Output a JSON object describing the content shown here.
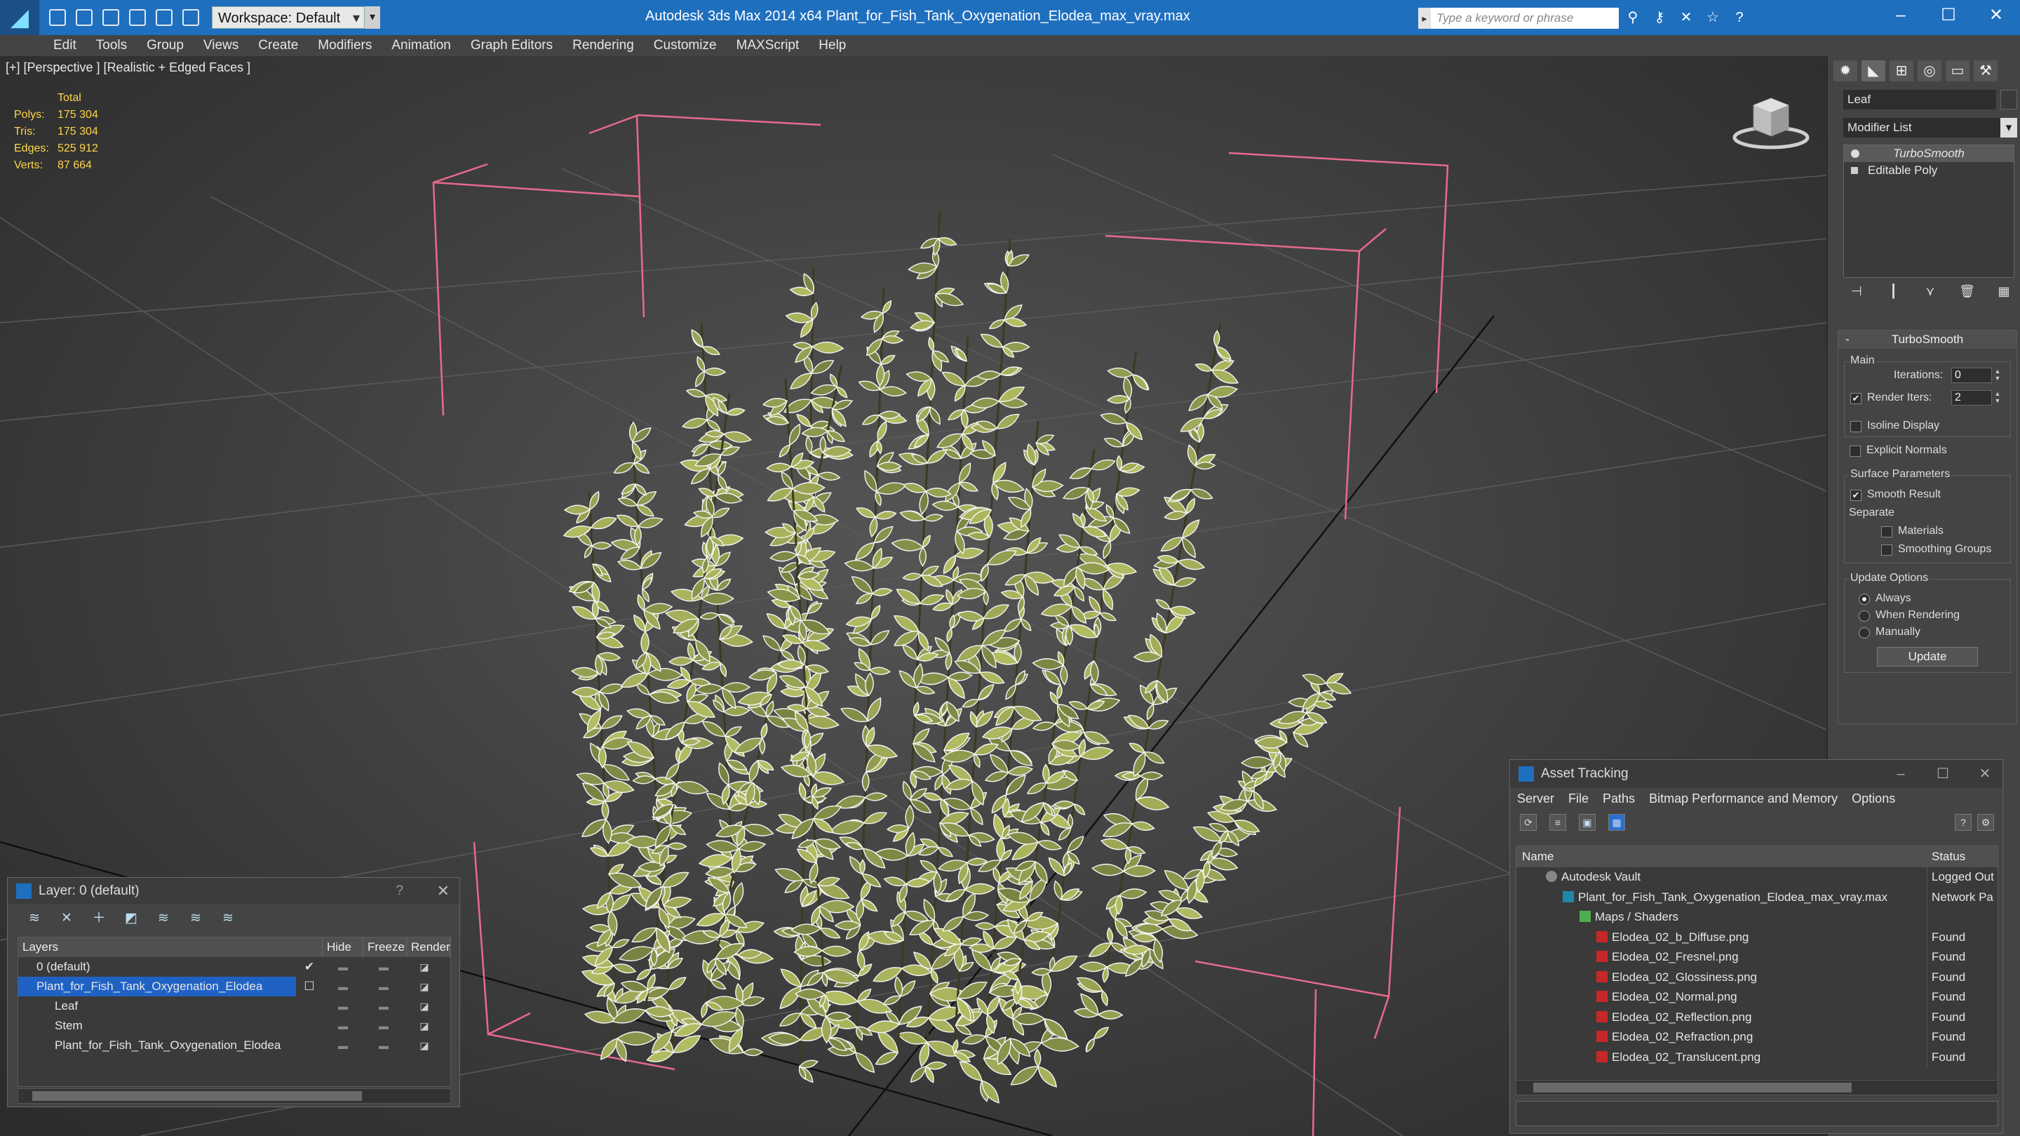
{
  "app": {
    "title": "Autodesk 3ds Max  2014 x64      Plant_for_Fish_Tank_Oxygenation_Elodea_max_vray.max",
    "workspace": "Workspace: Default",
    "search_placeholder": "Type a keyword or phrase"
  },
  "menu": [
    "Edit",
    "Tools",
    "Group",
    "Views",
    "Create",
    "Modifiers",
    "Animation",
    "Graph Editors",
    "Rendering",
    "Customize",
    "MAXScript",
    "Help"
  ],
  "viewport": {
    "label": "[+] [Perspective ] [Realistic + Edged Faces ]",
    "stats_header": "Total",
    "stats": [
      {
        "k": "Polys:",
        "v": "175 304"
      },
      {
        "k": "Tris:",
        "v": "175 304"
      },
      {
        "k": "Edges:",
        "v": "525 912"
      },
      {
        "k": "Verts:",
        "v": "87 664"
      }
    ]
  },
  "command_panel": {
    "object_name": "Leaf",
    "modifier_list": "Modifier List",
    "stack": [
      "TurboSmooth",
      "Editable Poly"
    ],
    "rollout_title": "TurboSmooth",
    "main_label": "Main",
    "iterations_label": "Iterations:",
    "iterations_value": "0",
    "render_iters_label": "Render Iters:",
    "render_iters_value": "2",
    "isoline_label": "Isoline Display",
    "explicit_label": "Explicit Normals",
    "surface_label": "Surface Parameters",
    "smooth_label": "Smooth Result",
    "separate_label": "Separate",
    "materials_label": "Materials",
    "smoothing_label": "Smoothing Groups",
    "update_opts_label": "Update Options",
    "always_label": "Always",
    "when_rendering_label": "When Rendering",
    "manually_label": "Manually",
    "update_button": "Update"
  },
  "layers": {
    "title": "Layer: 0 (default)",
    "help": "?",
    "columns": [
      "Layers",
      "Hide",
      "Freeze",
      "Render"
    ],
    "rows": [
      {
        "name": "0 (default)",
        "indent": 1,
        "selected": false
      },
      {
        "name": "Plant_for_Fish_Tank_Oxygenation_Elodea",
        "indent": 1,
        "selected": true
      },
      {
        "name": "Leaf",
        "indent": 2,
        "selected": false
      },
      {
        "name": "Stem",
        "indent": 2,
        "selected": false
      },
      {
        "name": "Plant_for_Fish_Tank_Oxygenation_Elodea",
        "indent": 2,
        "selected": false
      }
    ]
  },
  "asset_tracking": {
    "title": "Asset Tracking",
    "menu": [
      "Server",
      "File",
      "Paths",
      "Bitmap Performance and Memory",
      "Options"
    ],
    "columns": [
      "Name",
      "Status"
    ],
    "rows": [
      {
        "name": "Autodesk Vault",
        "status": "Logged Out",
        "indent": 1,
        "icon": "vault"
      },
      {
        "name": "Plant_for_Fish_Tank_Oxygenation_Elodea_max_vray.max",
        "status": "Network Pa",
        "indent": 2,
        "icon": "max"
      },
      {
        "name": "Maps / Shaders",
        "status": "",
        "indent": 3,
        "icon": "maps"
      },
      {
        "name": "Elodea_02_b_Diffuse.png",
        "status": "Found",
        "indent": 4,
        "icon": "png"
      },
      {
        "name": "Elodea_02_Fresnel.png",
        "status": "Found",
        "indent": 4,
        "icon": "png"
      },
      {
        "name": "Elodea_02_Glossiness.png",
        "status": "Found",
        "indent": 4,
        "icon": "png"
      },
      {
        "name": "Elodea_02_Normal.png",
        "status": "Found",
        "indent": 4,
        "icon": "png"
      },
      {
        "name": "Elodea_02_Reflection.png",
        "status": "Found",
        "indent": 4,
        "icon": "png"
      },
      {
        "name": "Elodea_02_Refraction.png",
        "status": "Found",
        "indent": 4,
        "icon": "png"
      },
      {
        "name": "Elodea_02_Translucent.png",
        "status": "Found",
        "indent": 4,
        "icon": "png"
      }
    ]
  },
  "colors": {
    "title_bar": "#1f6fbf",
    "selection": "#1f62c4",
    "bbox_lines": "#e86a8c",
    "stats_text": "#ffd54a",
    "leaf_fill": "#9a9a50"
  }
}
